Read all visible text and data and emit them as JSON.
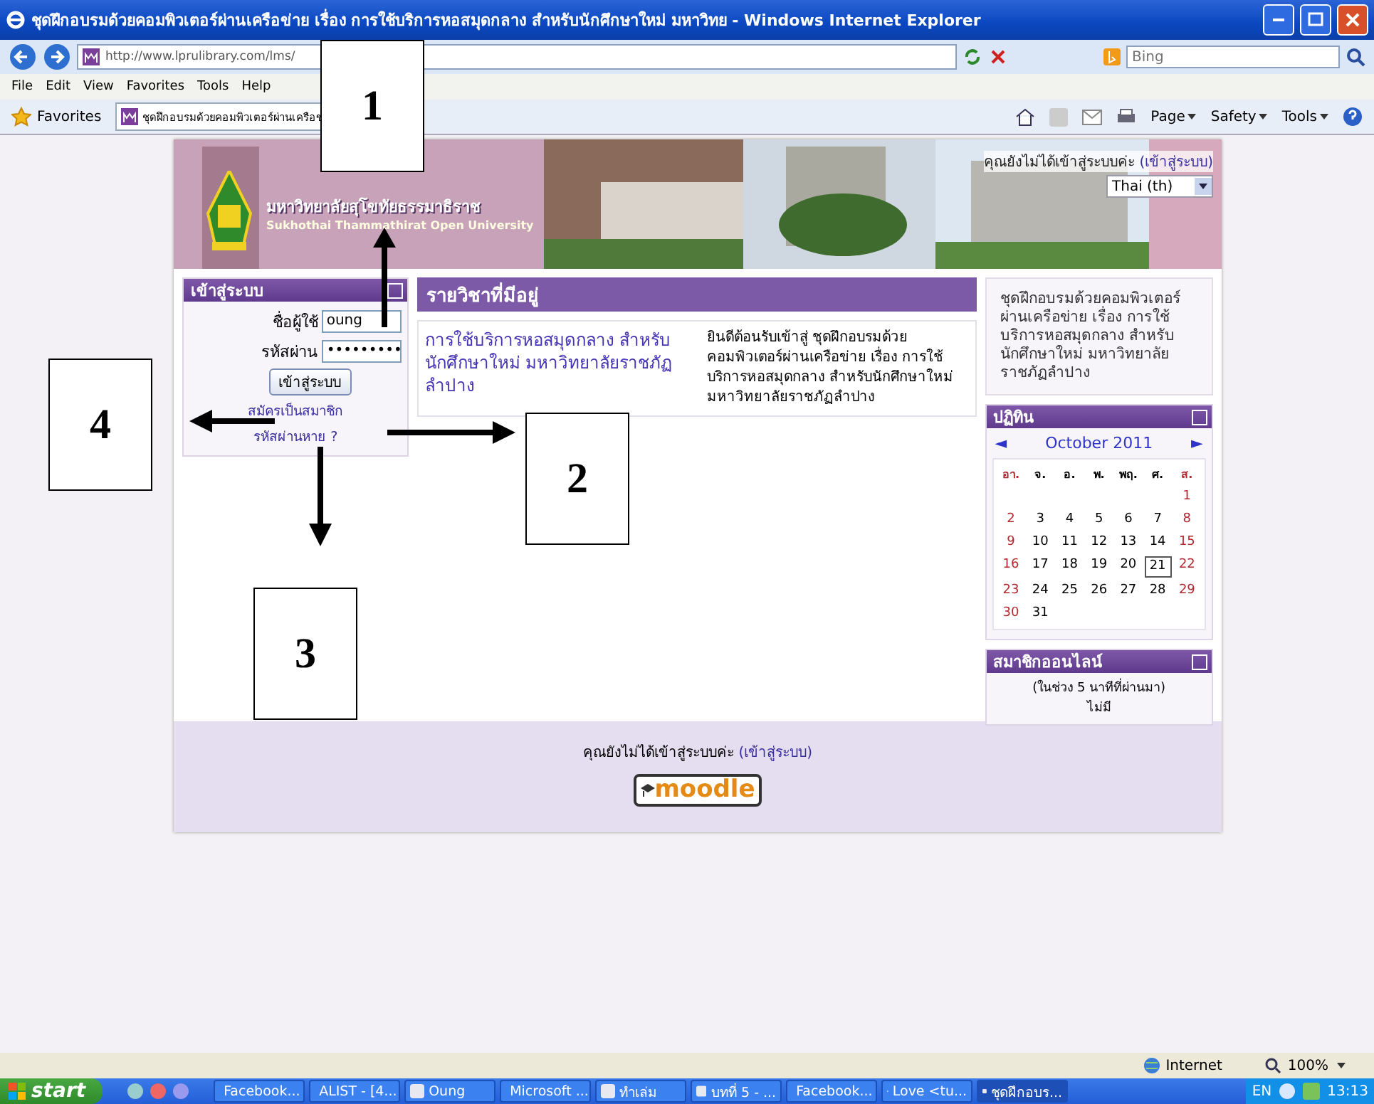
{
  "window": {
    "title": "ชุดฝึกอบรมด้วยคอมพิวเตอร์ผ่านเครือข่าย เรื่อง การใช้บริการหอสมุดกลาง สำหรับนักศึกษาใหม่ มหาวิทย - Windows Internet Explorer"
  },
  "toolbar": {
    "address": "http://www.lprulibrary.com/lms/",
    "search_placeholder": "Bing"
  },
  "menu": [
    "File",
    "Edit",
    "View",
    "Favorites",
    "Tools",
    "Help"
  ],
  "favorites_bar": {
    "label": "Favorites",
    "tab": "ชุดฝึกอบรมด้วยคอมพิวเตอร์ผ่านเครือข",
    "commands": [
      "Page",
      "Safety",
      "Tools"
    ]
  },
  "page": {
    "header": {
      "university_thai": "มหาวิทยาลัยสุโขทัยธรรมาธิราช",
      "university_en": "Sukhothai Thammathirat Open University",
      "login_notice": "คุณยังไม่ได้เข้าสู่ระบบค่ะ",
      "login_link": "(เข้าสู่ระบบ)",
      "language": "Thai (th)"
    },
    "login": {
      "title": "เข้าสู่ระบบ",
      "username_label": "ชื่อผู้ใช้",
      "username": "oung",
      "password_label": "รหัสผ่าน",
      "password": "•••••••••",
      "button": "เข้าสู่ระบบ",
      "links": [
        "สมัครเป็นสมาชิก",
        "รหัสผ่านหาย ?"
      ]
    },
    "courses": {
      "title": "รายวิชาที่มีอยู่",
      "items": [
        {
          "name": "การใช้บริการหอสมุดกลาง สำหรับนักศึกษาใหม่ มหาวิทยาลัยราชภัฏลำปาง",
          "summary": "ยินดีต้อนรับเข้าสู่ ชุดฝึกอบรมด้วยคอมพิวเตอร์ผ่านเครือข่าย เรื่อง การใช้บริการหอสมุดกลาง สำหรับนักศึกษาใหม่ มหาวิทยาลัยราชภัฏลำปาง"
        }
      ]
    },
    "site_summary": "ชุดฝึกอบรมด้วยคอมพิวเตอร์ผ่านเครือข่าย เรื่อง การใช้บริการหอสมุดกลาง สำหรับนักศึกษาใหม่ มหาวิทยาลัยราชภัฏลำปาง",
    "calendar": {
      "title": "ปฏิทิน",
      "prev": "◄",
      "month": "October 2011",
      "next": "►",
      "weekdays": [
        {
          "label": "อา.",
          "weekend": true
        },
        {
          "label": "จ.",
          "weekend": false
        },
        {
          "label": "อ.",
          "weekend": false
        },
        {
          "label": "พ.",
          "weekend": false
        },
        {
          "label": "พฤ.",
          "weekend": false
        },
        {
          "label": "ศ.",
          "weekend": false
        },
        {
          "label": "ส.",
          "weekend": true
        }
      ],
      "weeks": [
        [
          {
            "d": "1",
            "today": false
          }
        ],
        [
          {
            "d": "2",
            "today": false
          },
          {
            "d": "3",
            "today": false
          },
          {
            "d": "4",
            "today": false
          },
          {
            "d": "5",
            "today": false
          },
          {
            "d": "6",
            "today": false
          },
          {
            "d": "7",
            "today": false
          },
          {
            "d": "8",
            "today": false
          }
        ],
        [
          {
            "d": "9",
            "today": false
          },
          {
            "d": "10",
            "today": false
          },
          {
            "d": "11",
            "today": false
          },
          {
            "d": "12",
            "today": false
          },
          {
            "d": "13",
            "today": false
          },
          {
            "d": "14",
            "today": false
          },
          {
            "d": "15",
            "today": false
          }
        ],
        [
          {
            "d": "16",
            "today": false
          },
          {
            "d": "17",
            "today": false
          },
          {
            "d": "18",
            "today": false
          },
          {
            "d": "19",
            "today": false
          },
          {
            "d": "20",
            "today": false
          },
          {
            "d": "21",
            "today": true
          },
          {
            "d": "22",
            "today": false
          }
        ],
        [
          {
            "d": "23",
            "today": false
          },
          {
            "d": "24",
            "today": false
          },
          {
            "d": "25",
            "today": false
          },
          {
            "d": "26",
            "today": false
          },
          {
            "d": "27",
            "today": false
          },
          {
            "d": "28",
            "today": false
          },
          {
            "d": "29",
            "today": false
          }
        ],
        [
          {
            "d": "30",
            "today": false
          },
          {
            "d": "31",
            "today": false
          }
        ]
      ]
    },
    "online": {
      "title": "สมาชิกออนไลน์",
      "period": "(ในช่วง 5 นาทีที่ผ่านมา)",
      "none": "ไม่มี"
    },
    "footer": {
      "notice": "คุณยังไม่ได้เข้าสู่ระบบค่ะ",
      "link": "(เข้าสู่ระบบ)",
      "logo": "moodle"
    }
  },
  "status_bar": {
    "zone": "Internet",
    "zoom": "100%"
  },
  "taskbar": {
    "start": "start",
    "items": [
      {
        "label": "Facebook...",
        "selected": false
      },
      {
        "label": "ALIST - [4...",
        "selected": false
      },
      {
        "label": "Oung",
        "selected": false
      },
      {
        "label": "Microsoft ...",
        "selected": false
      },
      {
        "label": "ทำเล่ม",
        "selected": false
      },
      {
        "label": "บทที่ 5 - ...",
        "selected": false
      },
      {
        "label": "Facebook...",
        "selected": false
      },
      {
        "label": "Love <tu...",
        "selected": false
      },
      {
        "label": "ชุดฝึกอบร...",
        "selected": true
      }
    ],
    "language": "EN",
    "clock": "13:13"
  },
  "annotations": [
    {
      "label": "1"
    },
    {
      "label": "2"
    },
    {
      "label": "3"
    },
    {
      "label": "4"
    }
  ]
}
